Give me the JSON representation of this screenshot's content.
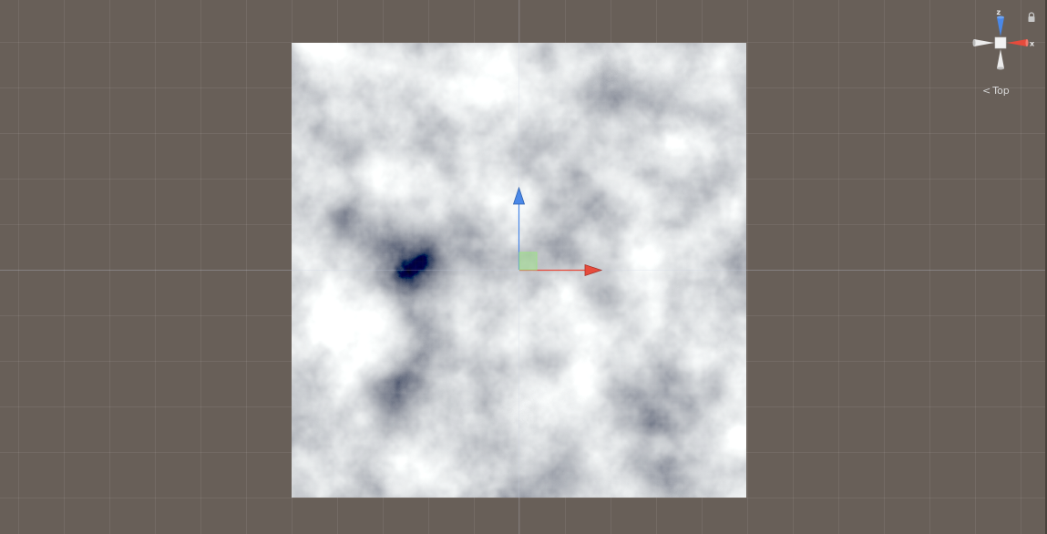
{
  "scene": {
    "background_color": "#685f58",
    "grid_color": "rgba(255,255,255,0.07)",
    "view_name": "Top"
  },
  "orientation_gizmo": {
    "axes": [
      {
        "axis": "z",
        "label": "z",
        "color": "#4a88e8"
      },
      {
        "axis": "x",
        "label": "x",
        "color": "#e64b3c"
      },
      {
        "axis": "-x",
        "label": "",
        "color": "#eeeeee"
      },
      {
        "axis": "-z",
        "label": "",
        "color": "#eeeeee"
      }
    ],
    "center_icon": "cube-center-icon",
    "lock_icon": "lock-icon"
  },
  "transform_gizmo": {
    "z_axis_color": "#4a88e8",
    "x_axis_color": "#e64b3c",
    "plane_handle_color": "#9fe08a"
  },
  "noise_texture": {
    "description_icon": "perlin-noise-plane"
  }
}
